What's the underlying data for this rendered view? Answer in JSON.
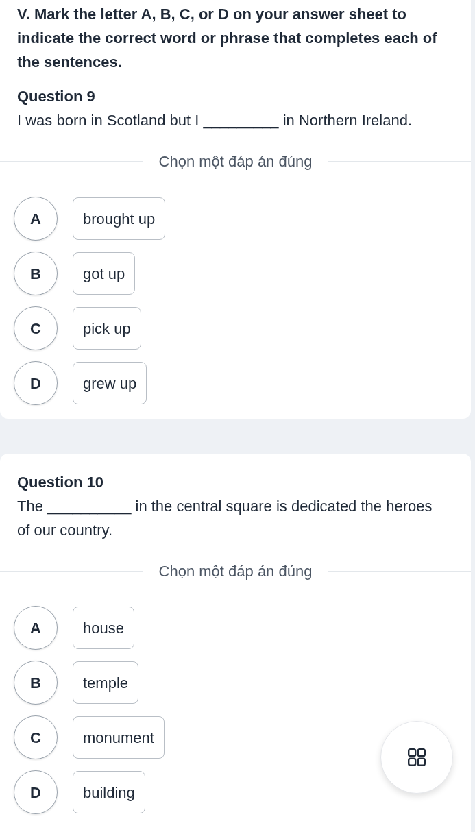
{
  "instructions": "V. Mark the letter A, B, C, or D on your answer sheet to indicate the correct word or phrase that completes each of the sentences.",
  "questions": [
    {
      "title": "Question 9",
      "sentence": "I was born in Scotland but I _________ in Northern Ireland.",
      "prompt": "Chọn một đáp án đúng",
      "options": [
        {
          "letter": "A",
          "text": "brought up",
          "selected": false
        },
        {
          "letter": "B",
          "text": "got up",
          "selected": false
        },
        {
          "letter": "C",
          "text": "pick up",
          "selected": false
        },
        {
          "letter": "D",
          "text": "grew up",
          "selected": false
        }
      ]
    },
    {
      "title": "Question 10",
      "sentence": "The __________ in the central square is dedicated the heroes of our country.",
      "prompt": "Chọn một đáp án đúng",
      "options": [
        {
          "letter": "A",
          "text": "house",
          "selected": false
        },
        {
          "letter": "B",
          "text": "temple",
          "selected": false
        },
        {
          "letter": "C",
          "text": "monument",
          "selected": false
        },
        {
          "letter": "D",
          "text": "building",
          "selected": false
        }
      ]
    }
  ]
}
